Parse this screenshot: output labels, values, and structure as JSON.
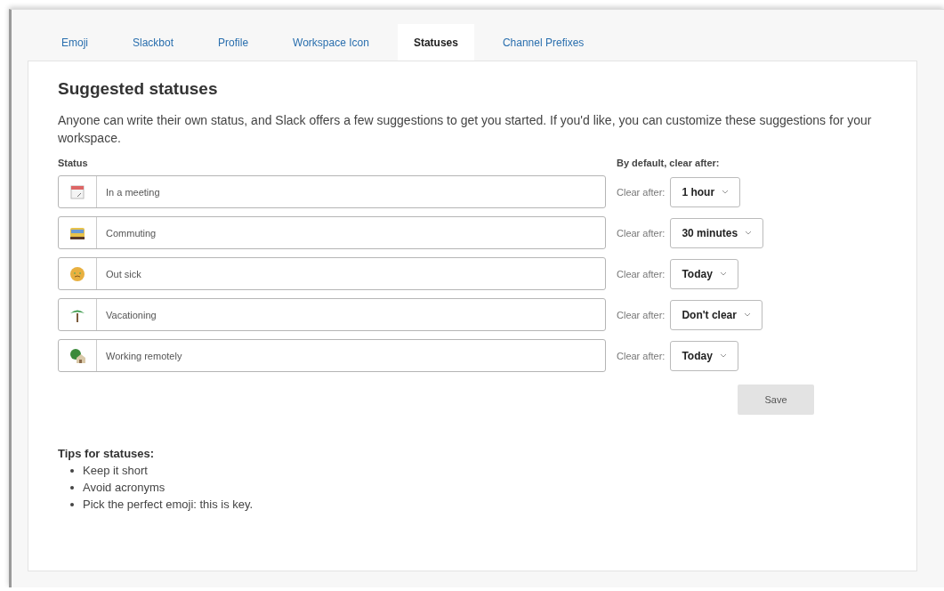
{
  "tabs": [
    {
      "label": "Emoji",
      "selected": false
    },
    {
      "label": "Slackbot",
      "selected": false
    },
    {
      "label": "Profile",
      "selected": false
    },
    {
      "label": "Workspace Icon",
      "selected": false
    },
    {
      "label": "Statuses",
      "selected": true
    },
    {
      "label": "Channel Prefixes",
      "selected": false
    }
  ],
  "heading": "Suggested statuses",
  "description": "Anyone can write their own status, and Slack offers a few suggestions to get you started. If you'd like, you can customize these suggestions for your workspace.",
  "columns": {
    "status": "Status",
    "clear": "By default, clear after:"
  },
  "statuses": [
    {
      "kind": "calendar",
      "value": "In a meeting",
      "clear_label": "Clear after:",
      "clear_after": "1 hour"
    },
    {
      "kind": "bus",
      "value": "Commuting",
      "clear_label": "Clear after:",
      "clear_after": "30 minutes"
    },
    {
      "kind": "sick",
      "value": "Out sick",
      "clear_label": "Clear after:",
      "clear_after": "Today"
    },
    {
      "kind": "palm",
      "value": "Vacationing",
      "clear_label": "Clear after:",
      "clear_after": "Don't clear"
    },
    {
      "kind": "house",
      "value": "Working remotely",
      "clear_label": "Clear after:",
      "clear_after": "Today"
    }
  ],
  "save_button": "Save",
  "tips": {
    "title": "Tips for statuses:",
    "items": [
      "Keep it short",
      "Avoid acronyms",
      "Pick the perfect emoji: this is key."
    ]
  }
}
